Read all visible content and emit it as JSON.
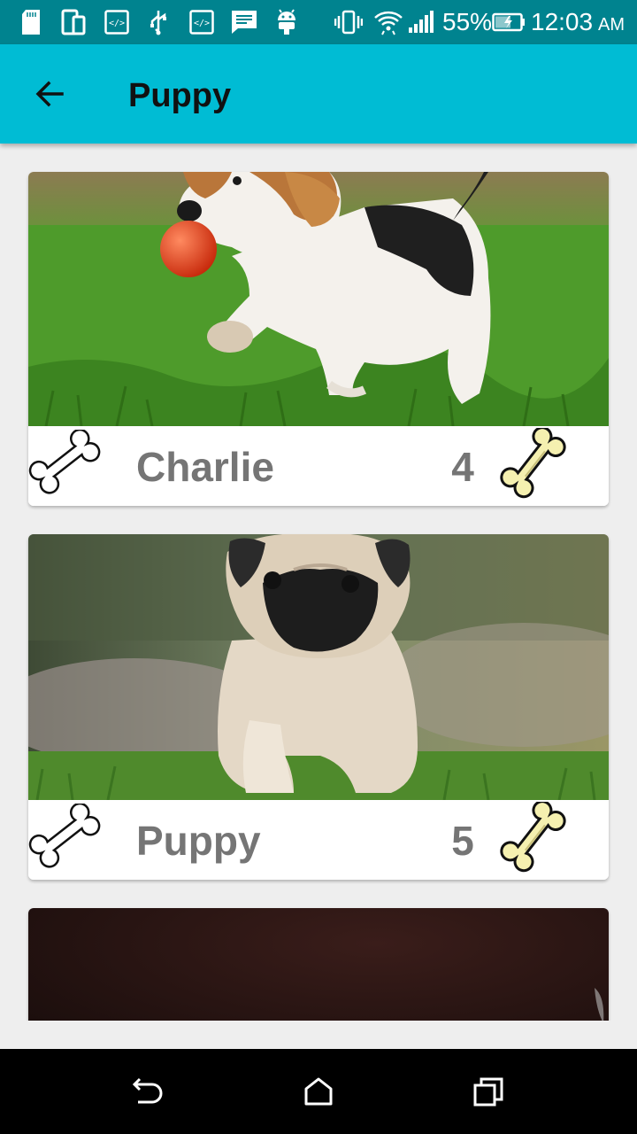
{
  "status_bar": {
    "battery_percent": "55%",
    "time": "12:03",
    "ampm": "AM",
    "icons": [
      "sd-card-icon",
      "device-icon",
      "code-icon",
      "usb-icon",
      "code-icon",
      "message-icon",
      "android-icon",
      "vibrate-icon",
      "wifi-icon",
      "signal-icon",
      "battery-charging-icon"
    ]
  },
  "app_bar": {
    "title": "Puppy",
    "back_icon": "arrow-back-icon"
  },
  "puppies": [
    {
      "name": "Charlie",
      "count": "4",
      "photo": "beagle-puppy-photo"
    },
    {
      "name": "Puppy",
      "count": "5",
      "photo": "pug-puppy-photo"
    },
    {
      "photo": "dark-puppy-photo"
    }
  ],
  "nav_bar": {
    "icons": [
      "back-icon",
      "home-icon",
      "recents-icon"
    ]
  },
  "colors": {
    "status_bar": "#00838f",
    "app_bar": "#00bcd4",
    "background": "#eeeeee",
    "label_text": "#757575",
    "bone_fill": "#f5f0b0"
  }
}
